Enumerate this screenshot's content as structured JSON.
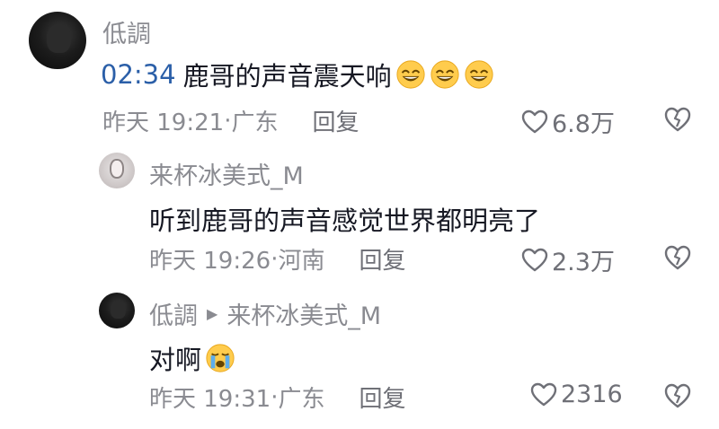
{
  "comments": [
    {
      "user": "低調",
      "timestamp_link": "02:34",
      "text": "鹿哥的声音震天响",
      "emoji": [
        "grin-sweat",
        "grin-sweat",
        "grin-sweat"
      ],
      "time": "昨天 19:21",
      "location": "广东",
      "reply_label": "回复",
      "likes": "6.8万"
    },
    {
      "user": "来杯冰美式_M",
      "text": "听到鹿哥的声音感觉世界都明亮了",
      "time": "昨天 19:26",
      "location": "河南",
      "reply_label": "回复",
      "likes": "2.3万"
    },
    {
      "user": "低調",
      "reply_to": "来杯冰美式_M",
      "text": "对啊",
      "emoji": [
        "crying-face"
      ],
      "time": "昨天 19:31",
      "location": "广东",
      "reply_label": "回复",
      "likes": "2316"
    }
  ],
  "separator": "·"
}
